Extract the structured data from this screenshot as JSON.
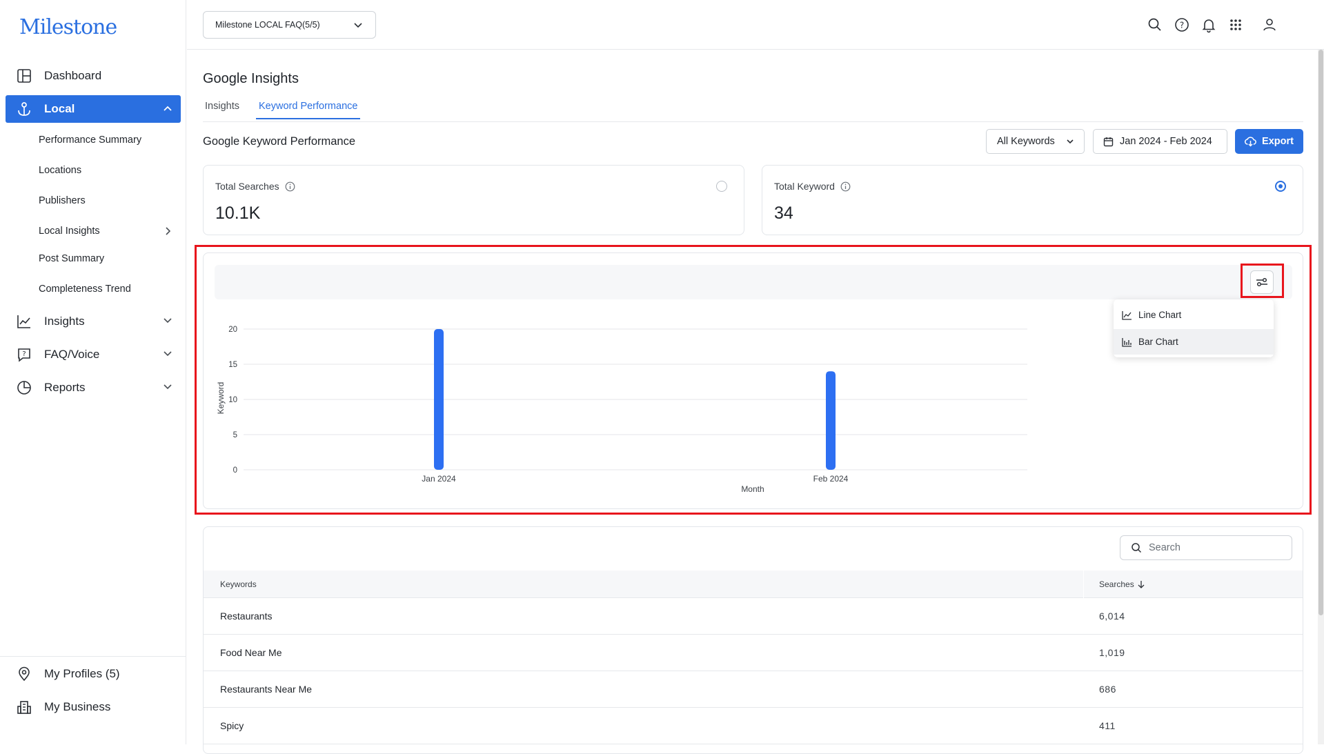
{
  "app": {
    "logo_text": "Milestone"
  },
  "sidebar": {
    "items": [
      {
        "label": "Dashboard",
        "icon": "layout-icon"
      },
      {
        "label": "Local",
        "icon": "anchor-icon",
        "active": true
      },
      {
        "label": "Insights",
        "icon": "line-chart-icon"
      },
      {
        "label": "FAQ/Voice",
        "icon": "faq-icon"
      },
      {
        "label": "Reports",
        "icon": "pie-chart-icon"
      }
    ],
    "sub_items": [
      {
        "label": "Performance Summary"
      },
      {
        "label": "Locations"
      },
      {
        "label": "Publishers"
      },
      {
        "label": "Local Insights"
      },
      {
        "label": "Post Summary"
      },
      {
        "label": "Completeness Trend"
      }
    ],
    "bottom": [
      {
        "label": "My Profiles (5)",
        "icon": "location-pin-icon"
      },
      {
        "label": "My Business",
        "icon": "building-icon"
      }
    ]
  },
  "topbar": {
    "profile_select": "Milestone LOCAL FAQ(5/5)",
    "icons": [
      "search-icon",
      "help-icon",
      "bell-icon",
      "apps-grid-icon",
      "user-icon"
    ]
  },
  "main": {
    "page_title": "Google Insights",
    "tabs": [
      {
        "label": "Insights",
        "active": false
      },
      {
        "label": "Keyword Performance",
        "active": true
      }
    ],
    "section_title": "Google Keyword Performance",
    "filter_keywords": "All Keywords",
    "date_range": "Jan 2024 - Feb 2024",
    "export_label": "Export",
    "cards": [
      {
        "label": "Total Searches",
        "value": "10.1K",
        "selected": false
      },
      {
        "label": "Total Keyword",
        "value": "34",
        "selected": true
      }
    ],
    "chart_menu": [
      {
        "label": "Line Chart",
        "icon": "line-chart-icon"
      },
      {
        "label": "Bar Chart",
        "icon": "bar-chart-icon"
      }
    ],
    "search_placeholder": "Search",
    "table": {
      "columns": [
        "Keywords",
        "Searches"
      ],
      "rows": [
        {
          "keyword": "Restaurants",
          "searches": "6,014"
        },
        {
          "keyword": "Food Near Me",
          "searches": "1,019"
        },
        {
          "keyword": "Restaurants Near Me",
          "searches": "686"
        },
        {
          "keyword": "Spicy",
          "searches": "411"
        }
      ]
    }
  },
  "colors": {
    "accent": "#2a6fe0",
    "highlight": "#e8141c",
    "bar": "#2d6ff2"
  },
  "chart_data": {
    "type": "bar",
    "categories": [
      "Jan 2024",
      "Feb 2024"
    ],
    "values": [
      20,
      14
    ],
    "xlabel": "Month",
    "ylabel": "Keyword",
    "ylim": [
      0,
      20
    ],
    "yticks": [
      0,
      5,
      10,
      15,
      20
    ],
    "grid": true
  }
}
